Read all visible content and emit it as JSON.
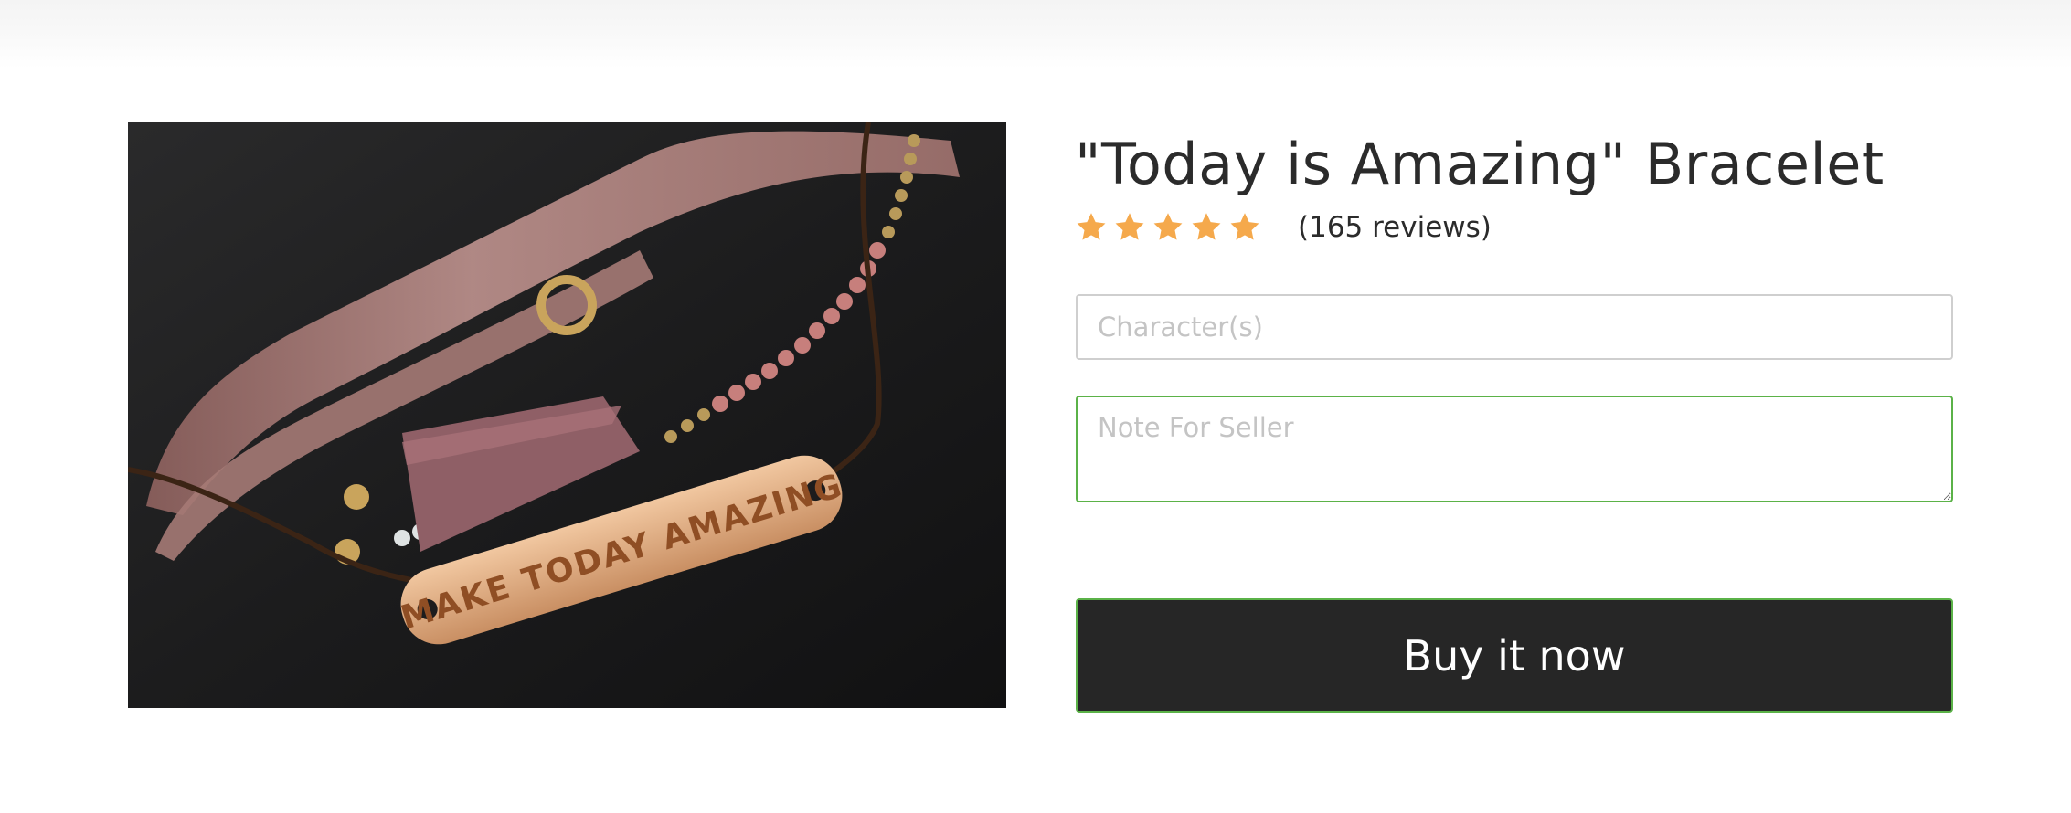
{
  "product": {
    "title": "\"Today is Amazing\" Bracelet",
    "image_alt": "Bracelet with MAKE TODAY AMAZING plate",
    "engraving": "MAKE TODAY AMAZING",
    "rating": 5,
    "rating_max": 5,
    "review_count_text": "(165 reviews)"
  },
  "form": {
    "characters_placeholder": "Character(s)",
    "characters_value": "",
    "note_placeholder": "Note For Seller",
    "note_value": ""
  },
  "actions": {
    "buy_label": "Buy it now"
  },
  "colors": {
    "star": "#f5a94c",
    "focus_border": "#5bb248",
    "button_bg": "#262626",
    "text": "#2b2b2b"
  },
  "icons": {
    "rating": "star-icon"
  }
}
